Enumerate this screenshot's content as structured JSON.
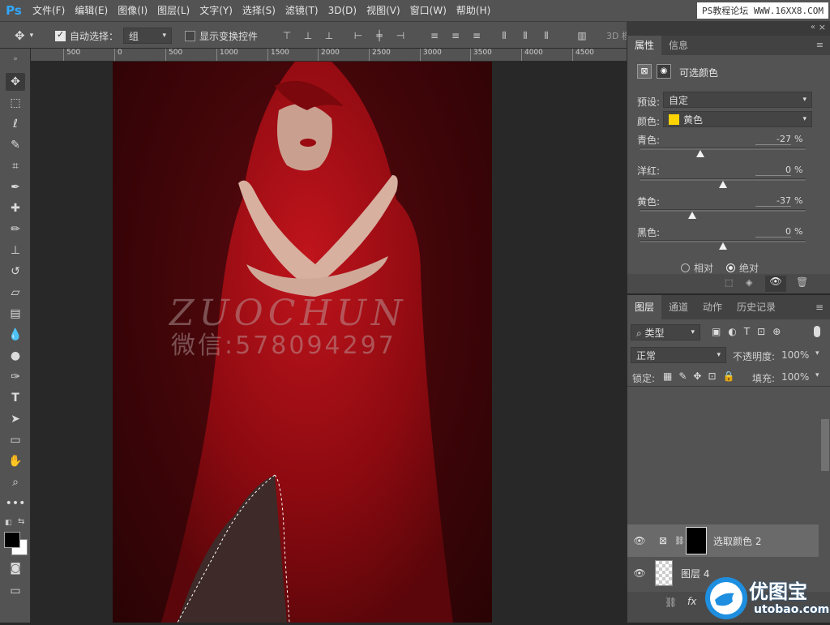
{
  "menu": {
    "logo": "Ps",
    "items": [
      "文件(F)",
      "编辑(E)",
      "图像(I)",
      "图层(L)",
      "文字(Y)",
      "选择(S)",
      "滤镜(T)",
      "3D(D)",
      "视图(V)",
      "窗口(W)",
      "帮助(H)"
    ],
    "watermark": "PS教程论坛 WWW.16XX8.COM"
  },
  "options": {
    "auto_select_label": "自动选择：",
    "auto_select_checked": true,
    "auto_select_value": "组",
    "show_transform_label": "显示变换控件",
    "show_transform_checked": false,
    "mode_3d": "3D 模"
  },
  "ruler": {
    "ticks": [
      "500",
      "0",
      "500",
      "1000",
      "1500",
      "2000",
      "2500",
      "3000",
      "3500",
      "4000",
      "4500"
    ]
  },
  "canvas": {
    "watermark_line1": "ZUOCHUN",
    "watermark_line2": "微信:578094297"
  },
  "properties": {
    "tabs": [
      "属性",
      "信息"
    ],
    "title": "可选颜色",
    "preset_label": "预设:",
    "preset_value": "自定",
    "colors_label": "颜色:",
    "colors_value": "黄色",
    "colors_swatch": "#ffd400",
    "sliders": [
      {
        "label": "青色:",
        "value": "-27",
        "fraction": 0.365
      },
      {
        "label": "洋红:",
        "value": "0",
        "fraction": 0.5
      },
      {
        "label": "黄色:",
        "value": "-37",
        "fraction": 0.315
      },
      {
        "label": "黑色:",
        "value": "0",
        "fraction": 0.5
      }
    ],
    "percent": "%",
    "relative_label": "相对",
    "absolute_label": "绝对",
    "method_selected": "absolute"
  },
  "layers": {
    "tabs": [
      "图层",
      "通道",
      "动作",
      "历史记录"
    ],
    "filter_label": "类型",
    "blend_mode": "正常",
    "opacity_label": "不透明度:",
    "opacity_value": "100%",
    "lock_label": "锁定:",
    "fill_label": "填充:",
    "fill_value": "100%",
    "items": [
      {
        "name": "选取颜色 2",
        "selected": true
      },
      {
        "name": "图层 4",
        "selected": false
      }
    ]
  },
  "branding": {
    "site_name": "优图宝",
    "site_url": "utobao.com"
  },
  "colors": {
    "ui_bg": "#535353",
    "canvas_bg": "#282828",
    "accent_blue": "#31a8ff"
  }
}
